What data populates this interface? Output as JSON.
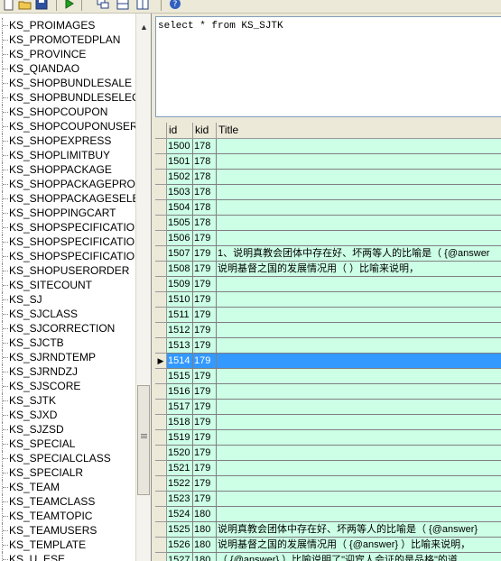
{
  "toolbar": {
    "buttons": [
      "new-icon",
      "open-icon",
      "save-icon",
      "run-icon",
      "tile-icon",
      "split-horizontal-icon",
      "split-vertical-icon",
      "help-icon"
    ]
  },
  "tree": {
    "items": [
      "KS_PROIMAGES",
      "KS_PROMOTEDPLAN",
      "KS_PROVINCE",
      "KS_QIANDAO",
      "KS_SHOPBUNDLESALE",
      "KS_SHOPBUNDLESELECT",
      "KS_SHOPCOUPON",
      "KS_SHOPCOUPONUSER",
      "KS_SHOPEXPRESS",
      "KS_SHOPLIMITBUY",
      "KS_SHOPPACKAGE",
      "KS_SHOPPACKAGEPRO",
      "KS_SHOPPACKAGESELECT",
      "KS_SHOPPINGCART",
      "KS_SHOPSPECIFICATION",
      "KS_SHOPSPECIFICATIONPI",
      "KS_SHOPSPECIFICATIONR",
      "KS_SHOPUSERORDER",
      "KS_SITECOUNT",
      "KS_SJ",
      "KS_SJCLASS",
      "KS_SJCORRECTION",
      "KS_SJCTB",
      "KS_SJRNDTEMP",
      "KS_SJRNDZJ",
      "KS_SJSCORE",
      "KS_SJTK",
      "KS_SJXD",
      "KS_SJZSD",
      "KS_SPECIAL",
      "KS_SPECIALCLASS",
      "KS_SPECIALR",
      "KS_TEAM",
      "KS_TEAMCLASS",
      "KS_TEAMTOPIC",
      "KS_TEAMUSERS",
      "KS_TEMPLATE",
      "KS_U_ESE"
    ]
  },
  "editor": {
    "sql": "select * from KS_SJTK"
  },
  "grid": {
    "columns": [
      "id",
      "kid",
      "Title"
    ],
    "selected_row": 14,
    "rows": [
      [
        "1500",
        "178",
        ""
      ],
      [
        "1501",
        "178",
        ""
      ],
      [
        "1502",
        "178",
        ""
      ],
      [
        "1503",
        "178",
        ""
      ],
      [
        "1504",
        "178",
        ""
      ],
      [
        "1505",
        "178",
        ""
      ],
      [
        "1506",
        "179",
        ""
      ],
      [
        "1507",
        "179",
        "1、说明真教会团体中存在好、坏两等人的比喻是（  {@answer"
      ],
      [
        "1508",
        "179",
        "说明基督之国的发展情况用（          ）比喻来说明，"
      ],
      [
        "1509",
        "179",
        ""
      ],
      [
        "1510",
        "179",
        ""
      ],
      [
        "1511",
        "179",
        ""
      ],
      [
        "1512",
        "179",
        ""
      ],
      [
        "1513",
        "179",
        ""
      ],
      [
        "1514",
        "179",
        ""
      ],
      [
        "1515",
        "179",
        ""
      ],
      [
        "1516",
        "179",
        ""
      ],
      [
        "1517",
        "179",
        ""
      ],
      [
        "1518",
        "179",
        ""
      ],
      [
        "1519",
        "179",
        ""
      ],
      [
        "1520",
        "179",
        ""
      ],
      [
        "1521",
        "179",
        ""
      ],
      [
        "1522",
        "179",
        ""
      ],
      [
        "1523",
        "179",
        ""
      ],
      [
        "1524",
        "180",
        ""
      ],
      [
        "1525",
        "180",
        "说明真教会团体中存在好、坏两等人的比喻是（   {@answer}"
      ],
      [
        "1526",
        "180",
        "说明基督之国的发展情况用（ {@answer} ）比喻来说明，"
      ],
      [
        "1527",
        "180",
        "（ {@answer}    ）比喻说明了\"迎宾人会证的是品格\"的道"
      ]
    ]
  }
}
